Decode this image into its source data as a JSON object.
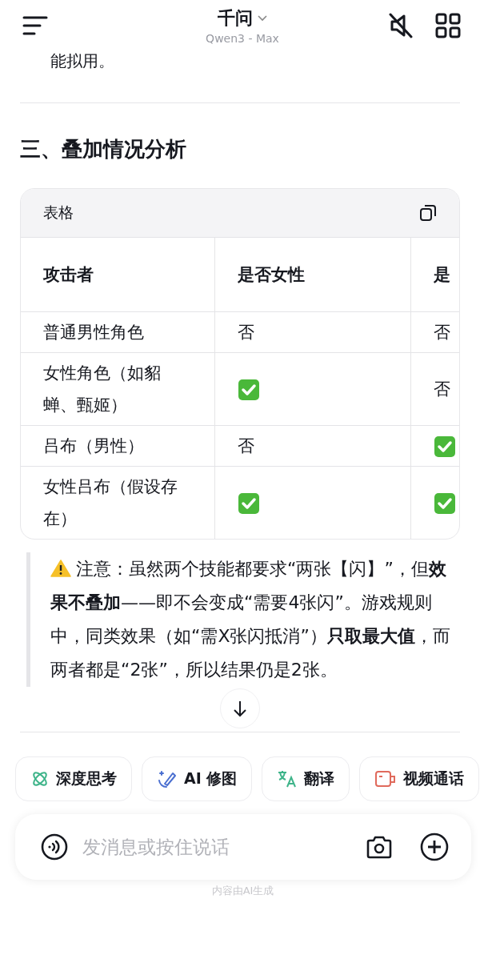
{
  "header": {
    "title": "千问",
    "subtitle": "Qwen3 - Max"
  },
  "partial_text": "能拟用。",
  "section_heading": "三、叠加情况分析",
  "table": {
    "label": "表格",
    "columns": [
      "攻击者",
      "是否女性",
      "是"
    ],
    "rows": [
      [
        {
          "kind": "text",
          "text": "普通男性角色"
        },
        {
          "kind": "text",
          "text": "否"
        },
        {
          "kind": "text",
          "text": "否"
        }
      ],
      [
        {
          "kind": "text",
          "text": "女性角色（如貂蝉、甄姬）"
        },
        {
          "kind": "check"
        },
        {
          "kind": "text",
          "text": "否"
        }
      ],
      [
        {
          "kind": "text",
          "text": "吕布（男性）"
        },
        {
          "kind": "text",
          "text": "否"
        },
        {
          "kind": "check"
        }
      ],
      [
        {
          "kind": "text",
          "text": "女性吕布（假设存在）"
        },
        {
          "kind": "check"
        },
        {
          "kind": "check"
        }
      ]
    ]
  },
  "note": "注意：虽然两个技能都要求“两张【闪】”，但**效果不叠加**——即不会变成“需要4张闪”。游戏规则中，同类效果（如“需X张闪抵消”）**只取最大值**，而两者都是“2张”，所以结果仍是2张。",
  "chips": [
    {
      "kind": "think",
      "label": "深度思考"
    },
    {
      "kind": "edit",
      "label": "AI 修图"
    },
    {
      "kind": "translate",
      "label": "翻译"
    },
    {
      "kind": "video",
      "label": "视频通话"
    }
  ],
  "input": {
    "placeholder": "发消息或按住说话"
  },
  "footer": "内容由AI生成"
}
